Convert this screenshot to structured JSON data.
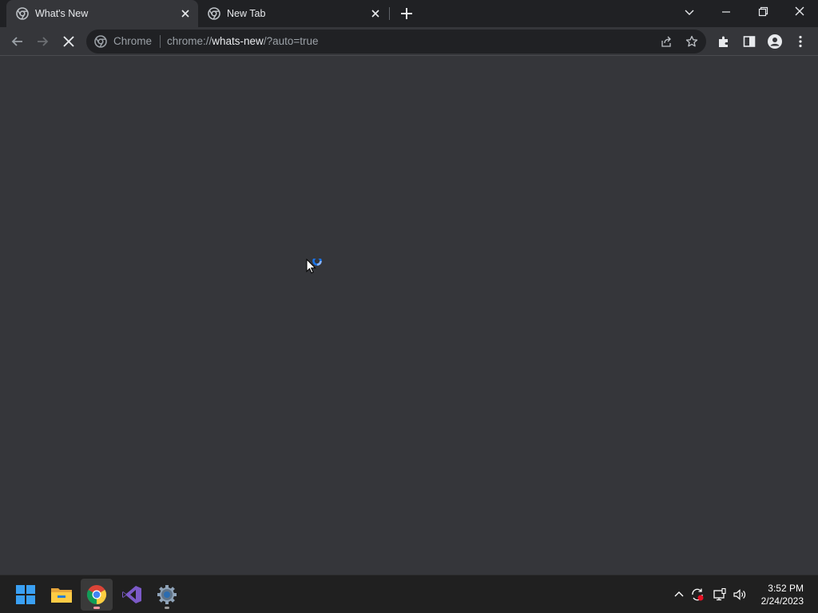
{
  "tabs": [
    {
      "title": "What's New",
      "icon": "chrome-favicon-icon",
      "active": true
    },
    {
      "title": "New Tab",
      "icon": "chrome-favicon-icon",
      "active": false
    }
  ],
  "omnibox": {
    "chip": "Chrome",
    "url_scheme": "chrome://",
    "url_host": "whats-new",
    "url_rest": "/?auto=true"
  },
  "taskbar": {
    "apps": [
      {
        "name": "start-button-icon"
      },
      {
        "name": "file-explorer-icon"
      },
      {
        "name": "chrome-icon",
        "running": true
      },
      {
        "name": "visual-studio-icon"
      },
      {
        "name": "settings-icon"
      }
    ],
    "clock": {
      "time": "3:52 PM",
      "date": "2/24/2023"
    }
  },
  "colors": {
    "tabstrip": "#202124",
    "page": "#35363a",
    "omnibox": "#202124",
    "taskbar": "#202020",
    "spinner": "#1a73e8"
  }
}
